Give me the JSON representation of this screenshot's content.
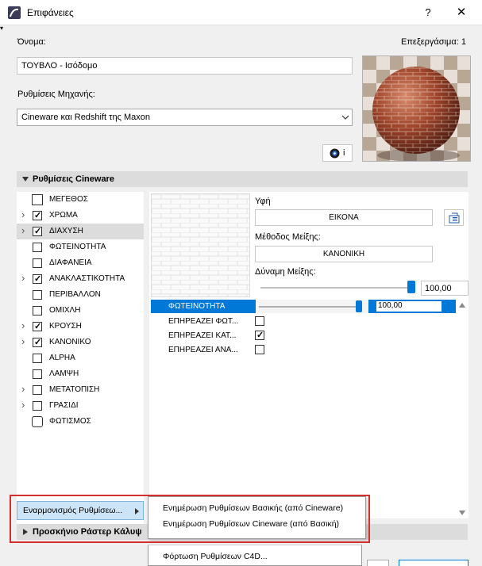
{
  "window": {
    "title": "Επιφάνειες",
    "help": "?",
    "close": "✕"
  },
  "name_label": "Όνομα:",
  "edit_label": "Επεξεργάσιμα: 1",
  "name_value": "ΤΟΥΒΛΟ - Ισόδομο",
  "engine_label": "Ρυθμίσεις Μηχανής:",
  "engine_value": "Cineware και Redshift της Maxon",
  "info_btn": "i",
  "section": "Ρυθμίσεις Cineware",
  "channels": [
    {
      "label": "ΜΕΓΕΘΟΣ",
      "arrow": false,
      "kind": "icon",
      "checked": false
    },
    {
      "label": "ΧΡΩΜΑ",
      "arrow": true,
      "kind": "check",
      "checked": true
    },
    {
      "label": "ΔΙΑΧΥΣΗ",
      "arrow": true,
      "kind": "check",
      "checked": true,
      "selected": true
    },
    {
      "label": "ΦΩΤΕΙΝΟΤΗΤΑ",
      "arrow": false,
      "kind": "check",
      "checked": false
    },
    {
      "label": "ΔΙΑΦΑΝΕΙΑ",
      "arrow": false,
      "kind": "check",
      "checked": false
    },
    {
      "label": "ΑΝΑΚΛΑΣΤΙΚΟΤΗΤΑ",
      "arrow": true,
      "kind": "check",
      "checked": true
    },
    {
      "label": "ΠΕΡΙΒΑΛΛΟΝ",
      "arrow": false,
      "kind": "check",
      "checked": false
    },
    {
      "label": "ΟΜΙΧΛΗ",
      "arrow": false,
      "kind": "check",
      "checked": false
    },
    {
      "label": "ΚΡΟΥΣΗ",
      "arrow": true,
      "kind": "check",
      "checked": true
    },
    {
      "label": "ΚΑΝΟΝΙΚΟ",
      "arrow": true,
      "kind": "check",
      "checked": true
    },
    {
      "label": "ALPHA",
      "arrow": false,
      "kind": "check",
      "checked": false
    },
    {
      "label": "ΛΑΜΨΗ",
      "arrow": false,
      "kind": "check",
      "checked": false
    },
    {
      "label": "ΜΕΤΑΤΟΠΙΣΗ",
      "arrow": true,
      "kind": "check",
      "checked": false
    },
    {
      "label": "ΓΡΑΣΙΔΙ",
      "arrow": true,
      "kind": "check",
      "checked": false
    },
    {
      "label": "ΦΩΤΙΣΜΟΣ",
      "arrow": false,
      "kind": "icon",
      "checked": false
    }
  ],
  "texture_label": "Υφή",
  "texture_btn": "ΕΙΚΟΝΑ",
  "mix_method_label": "Μέθοδος Μείξης:",
  "mix_method_btn": "ΚΑΝΟΝΙΚΗ",
  "mix_strength_label": "Δύναμη Μείξης:",
  "mix_strength_value": "100,00",
  "mix_strength_level": 1.0,
  "brightness_row": {
    "label": "ΦΩΤΕΙΝΟΤΗΤΑ",
    "value": "100,00",
    "level": 1.0
  },
  "affect_rows": [
    {
      "label": "ΕΠΗΡΕΑΖΕΙ ΦΩΤ...",
      "checked": false
    },
    {
      "label": "ΕΠΗΡΕΑΖΕΙ ΚΑΤ...",
      "checked": true
    },
    {
      "label": "ΕΠΗΡΕΑΖΕΙ ΑΝΑ...",
      "checked": false
    }
  ],
  "sync_btn": "Εναρμονισμός Ρυθμίσεω...",
  "raster_section": "Προσκήνιο Ράστερ Κάλυψ",
  "menu_items": [
    "Ενημέρωση Ρυθμίσεων Βασικής (από Cineware)",
    "Ενημέρωση Ρυθμίσεων Cineware (από Βασική)",
    "Φόρτωση Ρυθμίσεων C4D..."
  ],
  "colors": {
    "accent": "#0078d7",
    "highlight_red": "#d32f2f"
  }
}
